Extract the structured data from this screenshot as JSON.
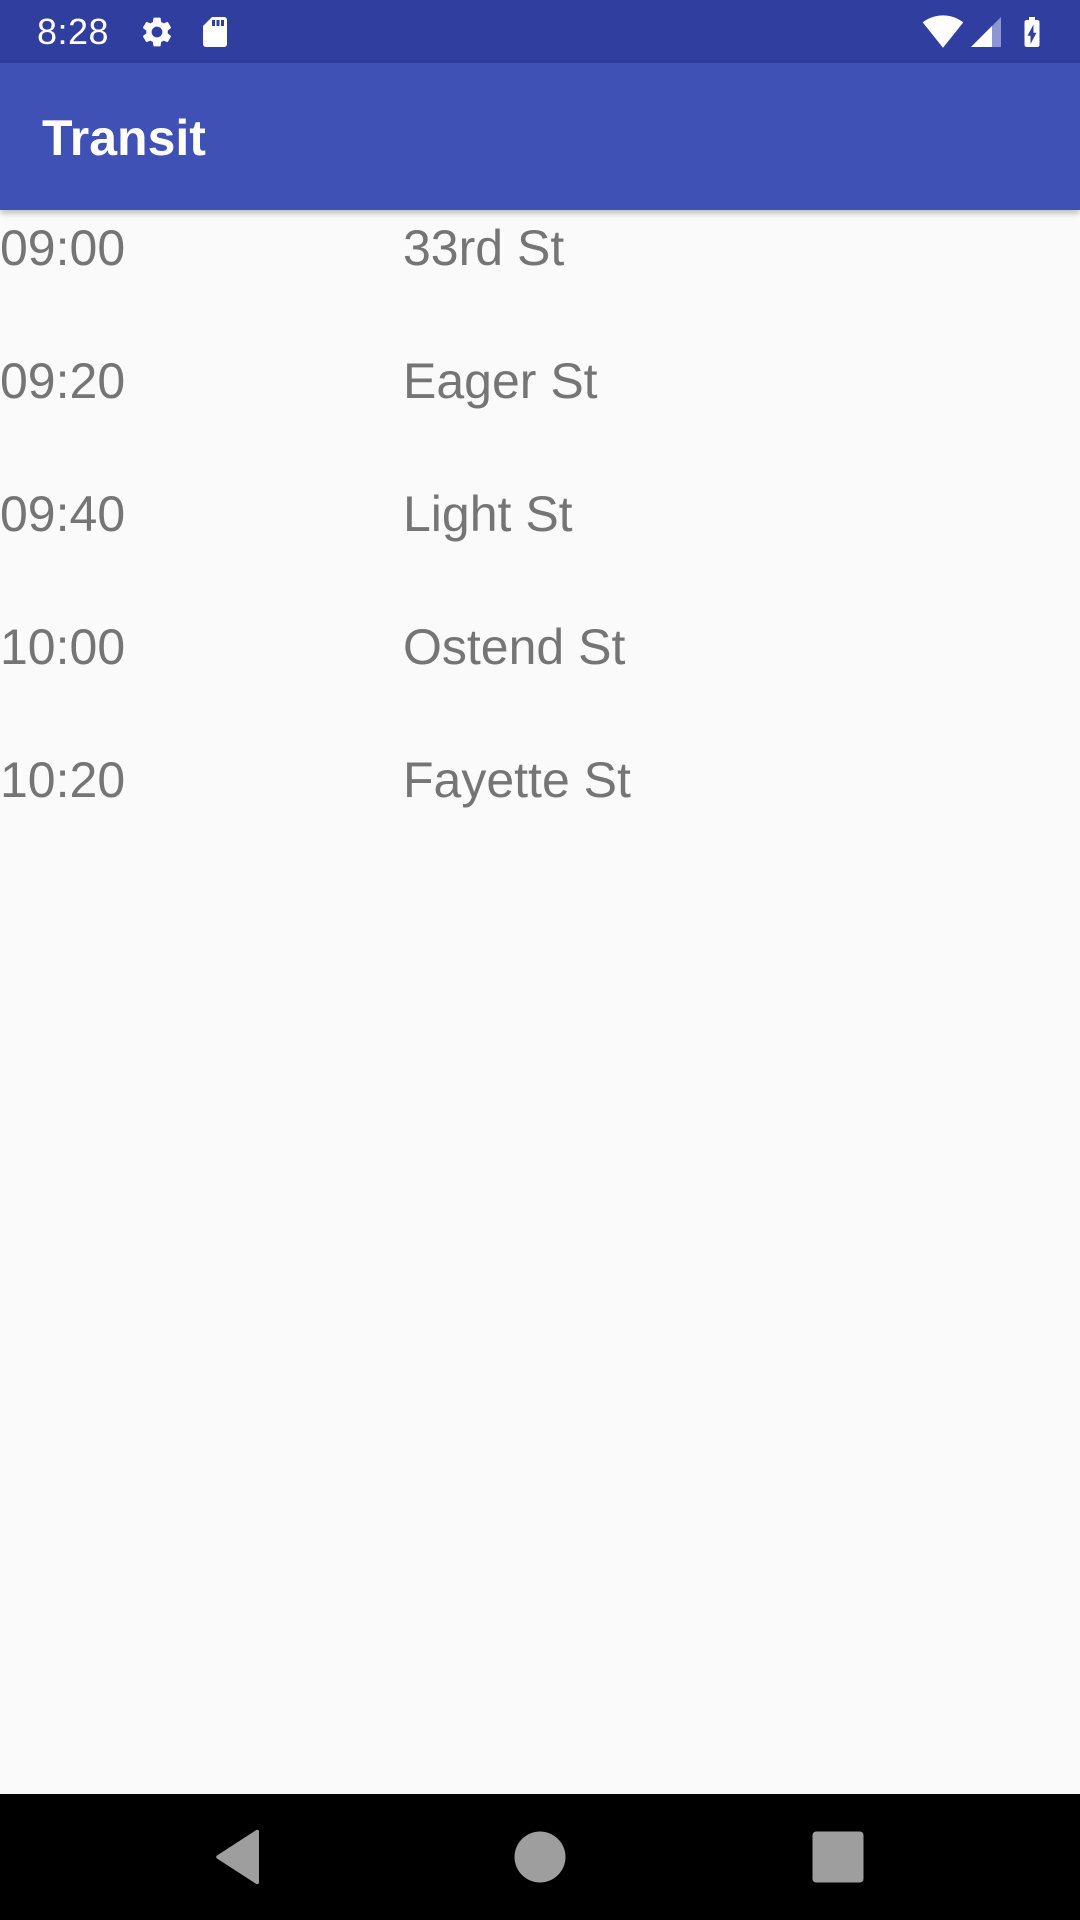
{
  "status_bar": {
    "time": "8:28",
    "icons": [
      "gear-icon",
      "sd-card-icon",
      "wifi-icon",
      "cell-signal-icon",
      "battery-charging-icon"
    ],
    "bg_color": "#303f9f"
  },
  "app_bar": {
    "title": "Transit",
    "bg_color": "#3f51b5"
  },
  "schedule": {
    "rows": [
      {
        "time": "09:00",
        "stop": "33rd St"
      },
      {
        "time": "09:20",
        "stop": "Eager St"
      },
      {
        "time": "09:40",
        "stop": "Light St"
      },
      {
        "time": "10:00",
        "stop": "Ostend St"
      },
      {
        "time": "10:20",
        "stop": "Fayette St"
      }
    ],
    "text_color": "#757575"
  },
  "nav_bar": {
    "buttons": [
      "back-icon",
      "home-icon",
      "recents-icon"
    ]
  }
}
